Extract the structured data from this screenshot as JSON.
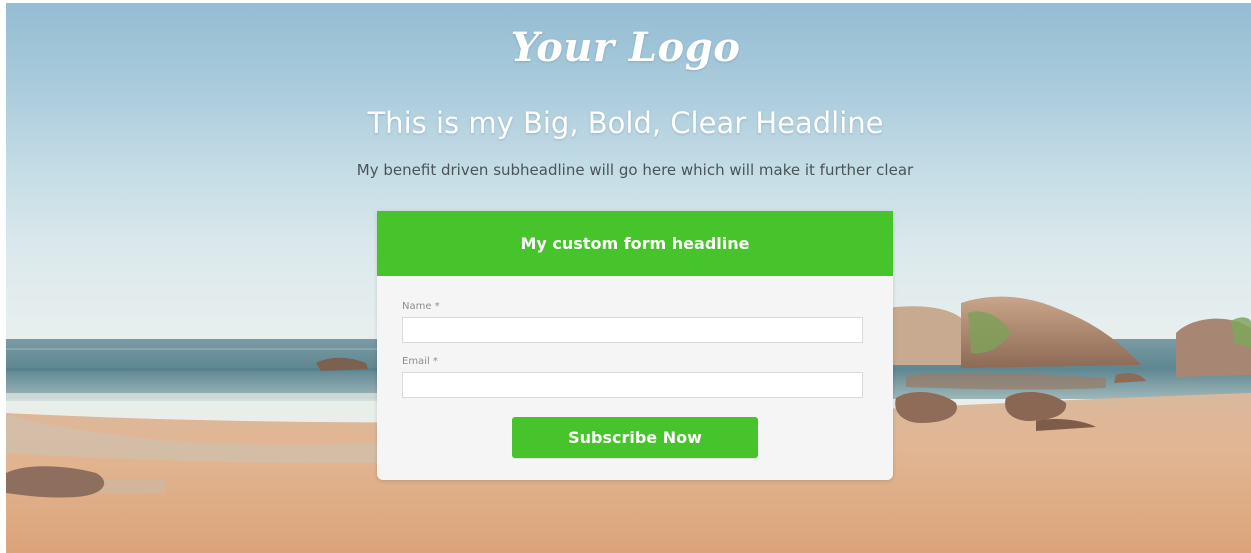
{
  "hero": {
    "logo": "Your Logo",
    "headline": "This is my Big, Bold, Clear Headline",
    "subheadline": "My benefit driven subheadline will go here which will make it further clear"
  },
  "form": {
    "headline": "My custom form headline",
    "fields": [
      {
        "label": "Name *",
        "value": "",
        "placeholder": ""
      },
      {
        "label": "Email *",
        "value": "",
        "placeholder": ""
      }
    ],
    "submit_label": "Subscribe Now"
  },
  "colors": {
    "accent": "#47c42b",
    "sky": "#a9cbdc",
    "sand": "#e4b48c",
    "sea": "#5b8794"
  }
}
